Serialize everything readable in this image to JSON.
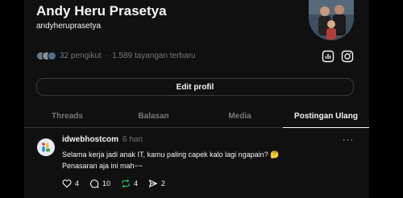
{
  "profile": {
    "name": "Andy Heru Prasetya",
    "handle": "andyheruprasetya",
    "followers": "32 pengikut",
    "separator": "·",
    "views": "1.589 tayangan terbaru",
    "edit_label": "Edit profil"
  },
  "tabs": [
    {
      "label": "Threads",
      "active": false
    },
    {
      "label": "Balasan",
      "active": false
    },
    {
      "label": "Media",
      "active": false
    },
    {
      "label": "Postingan Ulang",
      "active": true
    }
  ],
  "post": {
    "user": "idwebhostcom",
    "time": "6 hari",
    "more": "···",
    "line1": "Selama kerja jadi anak IT, kamu paling capek kalo lagi ngapain? 🤔",
    "line2": "Penasaran aja ini mah~~",
    "likes": "4",
    "replies": "10",
    "reposts": "4",
    "shares": "2"
  },
  "colors": {
    "background": "#101010",
    "text": "#f3f5f7",
    "muted": "#777777",
    "border": "#333333"
  }
}
